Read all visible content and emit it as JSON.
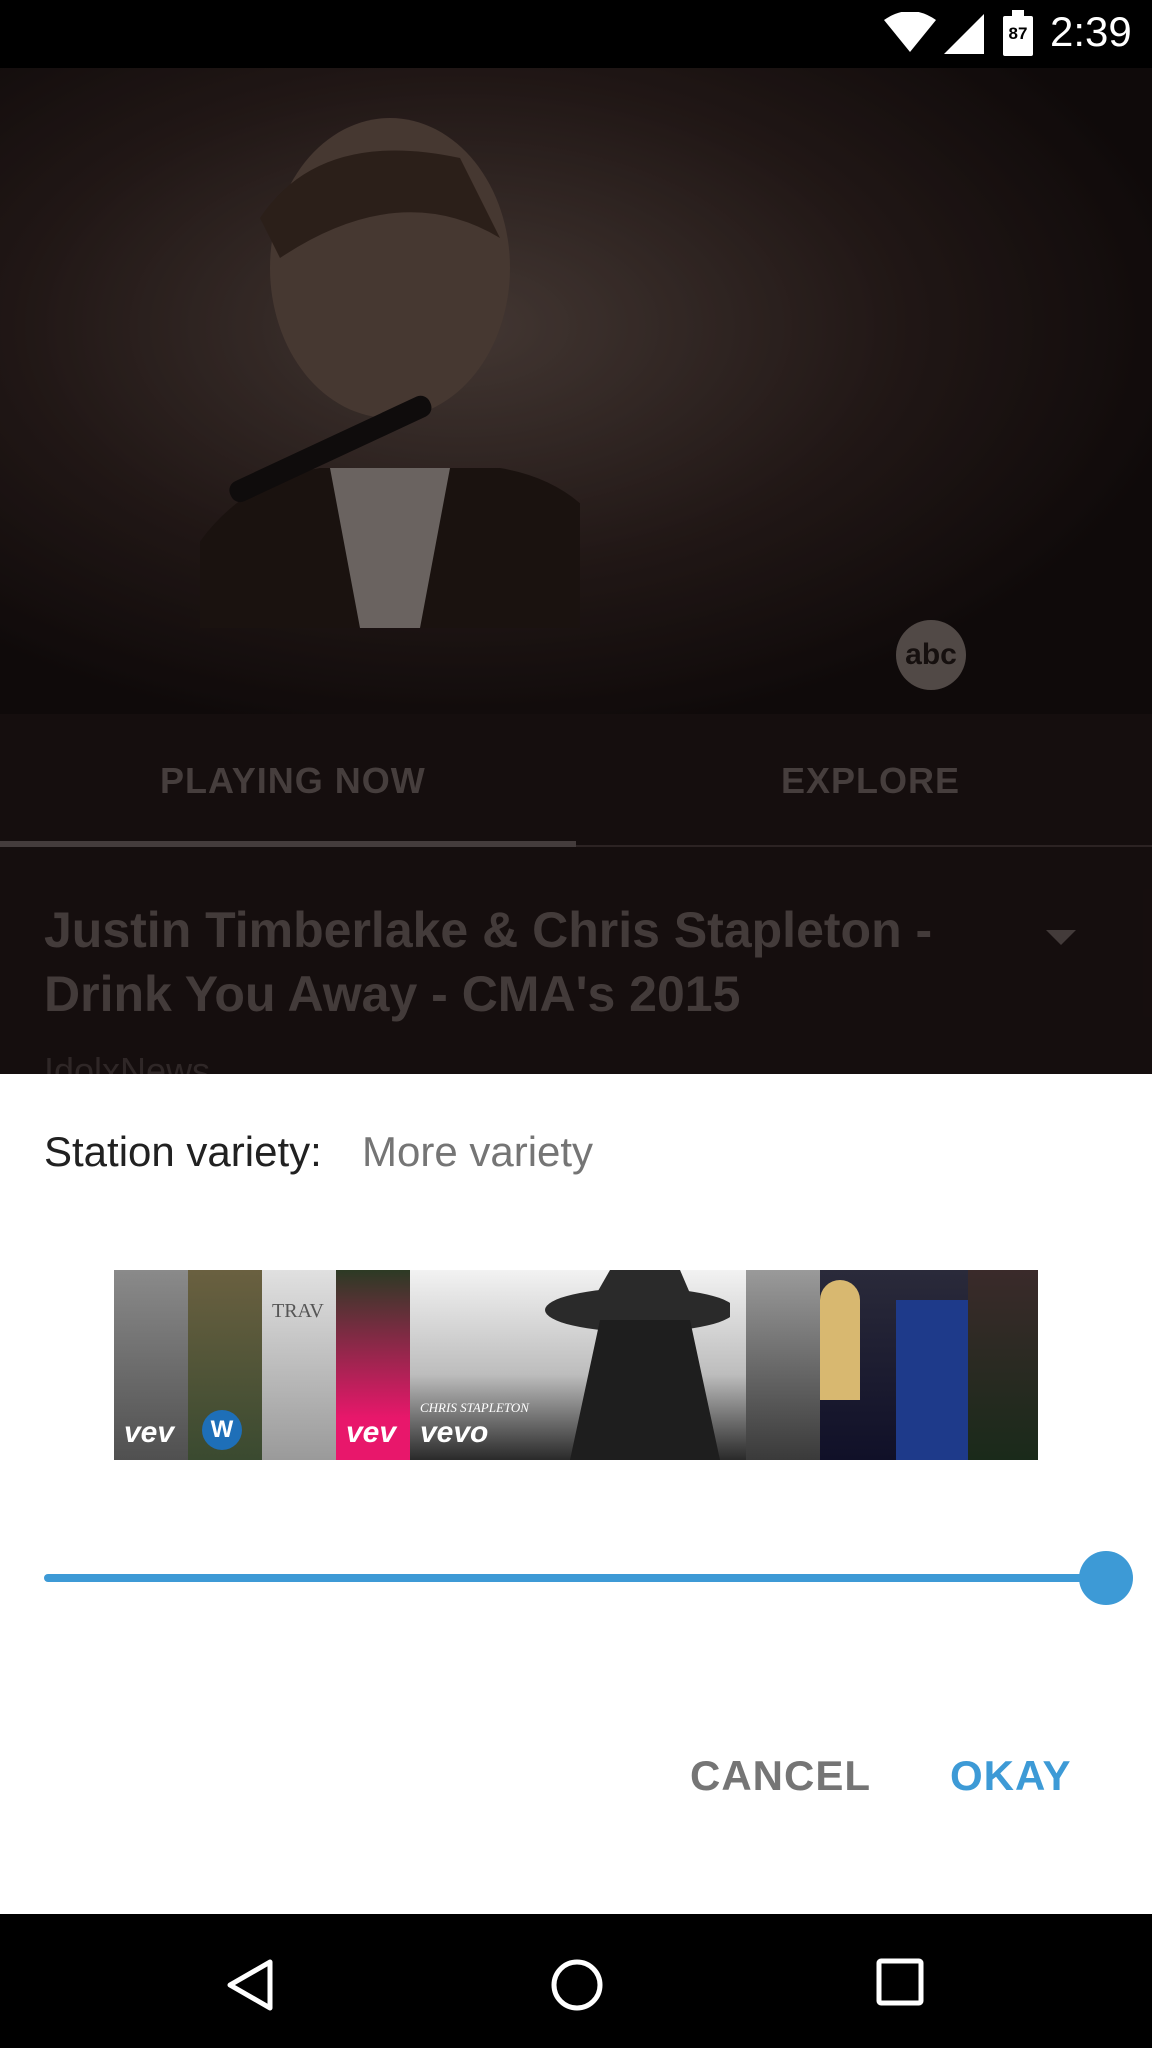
{
  "status_bar": {
    "time": "2:39",
    "battery": "87"
  },
  "tabs": [
    {
      "label": "PLAYING NOW"
    },
    {
      "label": "EXPLORE"
    }
  ],
  "now_playing": {
    "title": "Justin Timberlake & Chris Stapleton - Drink You Away - CMA's 2015",
    "channel": "IdolxNews"
  },
  "video": {
    "watermark": "abc"
  },
  "dialog": {
    "variety_label": "Station variety:",
    "variety_value": "More variety",
    "slider_level": 1.0,
    "cancel_label": "CANCEL",
    "okay_label": "OKAY"
  },
  "filmstrip": {
    "thumbnails": [
      {
        "name": "vevo-thumb-1",
        "logo": "vev"
      },
      {
        "name": "warner-thumb",
        "logo": "W"
      },
      {
        "name": "travis-thumb",
        "logo": "TRAV"
      },
      {
        "name": "vevo-thumb-2",
        "logo": "vev"
      },
      {
        "name": "stapleton-thumb",
        "logo": "vevo",
        "caption": "CHRIS STAPLETON"
      },
      {
        "name": "thumb-6",
        "logo": ""
      },
      {
        "name": "drums-thumb",
        "logo": ""
      },
      {
        "name": "guitar-thumb",
        "logo": ""
      }
    ]
  },
  "colors": {
    "accent": "#3d9ad6",
    "dialog_bg": "#ffffff",
    "text_primary": "#212121",
    "text_secondary": "#757575"
  },
  "icons": [
    "wifi-icon",
    "signal-icon",
    "battery-icon",
    "dropdown-arrow-icon",
    "back-icon",
    "home-icon",
    "recents-icon"
  ]
}
